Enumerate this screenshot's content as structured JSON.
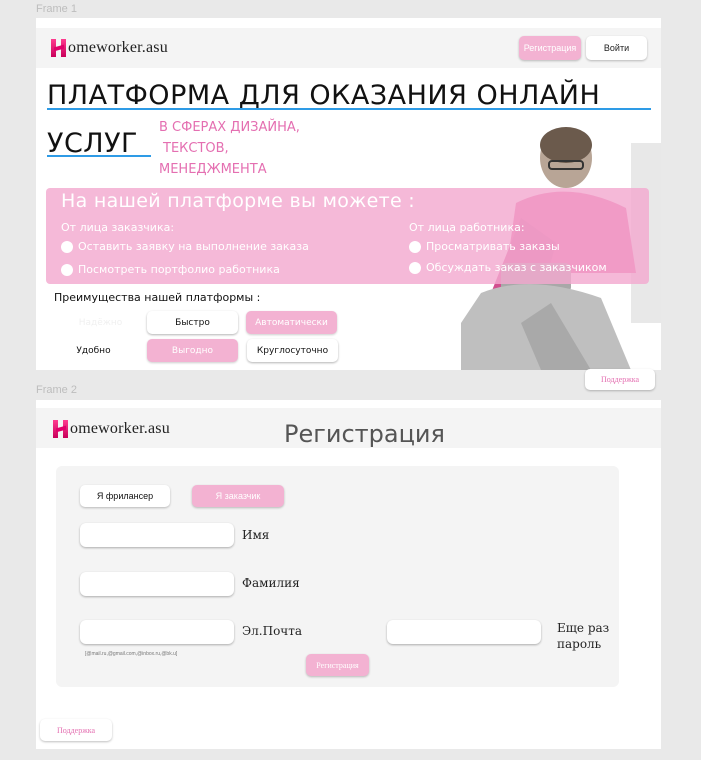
{
  "frames": {
    "frame1_label": "Frame 1",
    "frame2_label": "Frame 2"
  },
  "brand": {
    "logo_letter": "H",
    "logo_text": "omeworker.asu",
    "accent": "#e0006a",
    "pink": "#f3b2d2"
  },
  "frame1": {
    "nav": {
      "register_label": "Регистрация",
      "login_label": "Войти"
    },
    "hero": {
      "title_line1": "ПЛАТФОРМА ДЛЯ ОКАЗАНИЯ ОНЛАЙН",
      "title_line2": "УСЛУГ",
      "subtitle_line1": "В СФЕРАХ ДИЗАЙНА,",
      "subtitle_line2": "ТЕКСТОВ,",
      "subtitle_line3": "МЕНЕДЖМЕНТА"
    },
    "panel": {
      "title": "На нашей платформе вы можете :",
      "customer_heading": "От лица заказчика:",
      "customer_items": [
        "Оставить заявку на выполнение заказа",
        "Посмотреть портфолио работника"
      ],
      "worker_heading": "От лица работника:",
      "worker_items": [
        "Просматривать заказы",
        "Обсуждать заказ с заказчиком"
      ]
    },
    "advantages": {
      "title": "Преимущества нашей платформы :",
      "items": [
        "Надёжно",
        "Быстро",
        "Автоматически",
        "Удобно",
        "Выгодно",
        "Круглосуточно"
      ]
    },
    "support_label": "Поддержка"
  },
  "frame2": {
    "title": "Регистрация",
    "role_freelancer": "Я фрилансер",
    "role_customer": "Я заказчик",
    "fields": {
      "first_name": "Имя",
      "last_name": "Фамилия",
      "email": "Эл.Почта",
      "password_repeat_line1": "Еще раз",
      "password_repeat_line2": "пароль"
    },
    "email_hint": "[@mail.ru,@gmail.com,@inbox.ru,@bk.u]",
    "submit_label": "Регистрация",
    "support_label": "Поддержка"
  }
}
